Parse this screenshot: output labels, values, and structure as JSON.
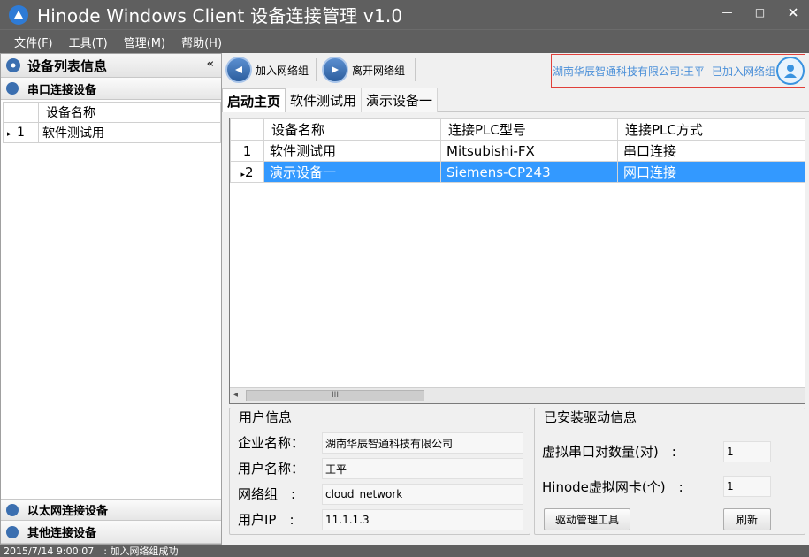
{
  "window": {
    "title": "Hinode Windows Client 设备连接管理 v1.0",
    "minimize": "—",
    "maximize": "□"
  },
  "menu": [
    "文件(F)",
    "工具(T)",
    "管理(M)",
    "帮助(H)"
  ],
  "left_panel": {
    "header": "设备列表信息",
    "collapse": "«",
    "serial_section": "串口连接设备",
    "column_header": "设备名称",
    "rows": [
      {
        "num": "1",
        "name": "软件测试用",
        "marker": "▸"
      }
    ],
    "ethernet_section": "以太网连接设备",
    "other_section": "其他连接设备"
  },
  "toolbar": {
    "join_label": "加入网络组",
    "leave_label": "离开网络组",
    "company_text": "湖南华辰智通科技有限公司:王平",
    "joined_text": "已加入网络组"
  },
  "tabs": [
    "启动主页",
    "软件测试用",
    "演示设备一"
  ],
  "device_grid": {
    "headers": [
      "设备名称",
      "连接PLC型号",
      "连接PLC方式"
    ],
    "rows": [
      {
        "num": "1",
        "name": "软件测试用",
        "model": "Mitsubishi-FX",
        "mode": "串口连接",
        "marker": ""
      },
      {
        "num": "2",
        "name": "演示设备一",
        "model": "Siemens-CP243",
        "mode": "网口连接",
        "marker": "▸"
      }
    ],
    "scroll_left": "◂",
    "scroll_thumb": "III"
  },
  "user_info": {
    "title": "用户信息",
    "company_label": "企业名称：",
    "company_value": "湖南华辰智通科技有限公司",
    "user_label": "用户名称：",
    "user_value": "王平",
    "group_label": "网络组　:",
    "group_value": "cloud_network",
    "ip_label": "用户IP　:",
    "ip_value": "11.1.1.3"
  },
  "driver_info": {
    "title": "已安装驱动信息",
    "serial_label": "虚拟串口对数量(对)　:",
    "serial_value": "1",
    "nic_label": "Hinode虚拟网卡(个)　:",
    "nic_value": "1",
    "tool_button": "驱动管理工具",
    "refresh_button": "刷新"
  },
  "status": {
    "text": "2015/7/14 9:00:07　: 加入网络组成功"
  },
  "colors": {
    "chrome": "#5f5f5f",
    "selection": "#3399ff",
    "accent_text": "#4a8fd8",
    "highlight_border": "#e0403a"
  }
}
